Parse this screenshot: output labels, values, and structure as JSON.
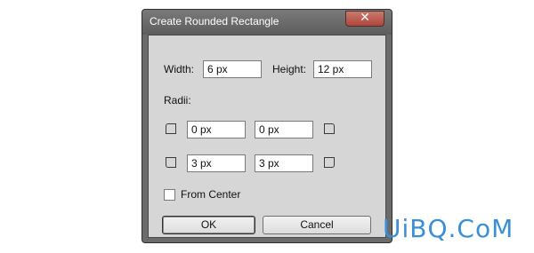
{
  "dialog": {
    "title": "Create Rounded Rectangle",
    "close_label": "✕"
  },
  "size": {
    "width_label": "Width:",
    "width_value": "6 px",
    "height_label": "Height:",
    "height_value": "12 px"
  },
  "radii": {
    "label": "Radii:",
    "top_left": "0 px",
    "top_right": "0 px",
    "bottom_left": "3 px",
    "bottom_right": "3 px"
  },
  "from_center": {
    "label": "From Center",
    "checked": false
  },
  "buttons": {
    "ok": "OK",
    "cancel": "Cancel"
  },
  "watermark": "UiBQ.CoM",
  "colors": {
    "dialog_frame": "#6b6b6b",
    "dialog_body": "#d6d6d6",
    "close_button": "#b0463a",
    "watermark": "#3a8fd8"
  }
}
